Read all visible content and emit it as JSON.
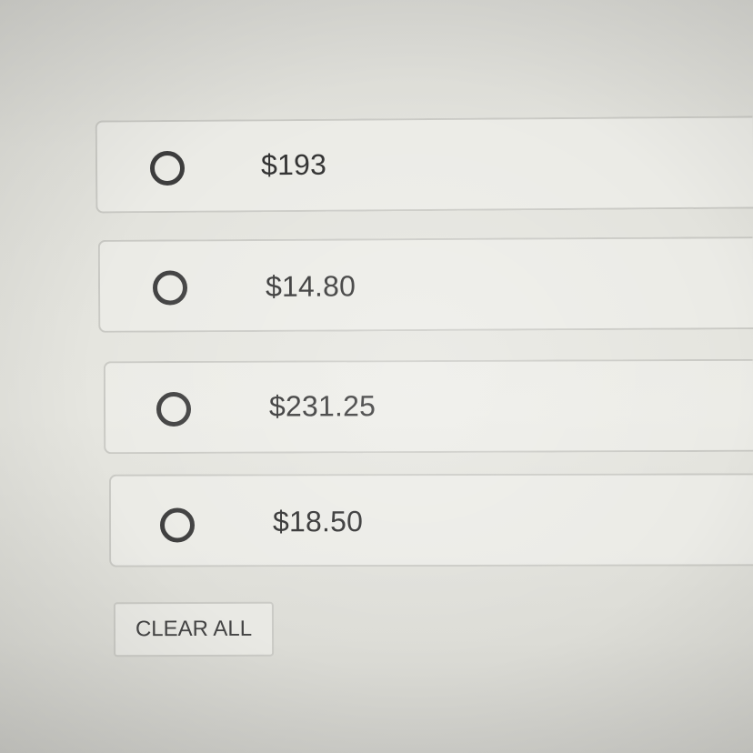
{
  "options": [
    {
      "label": "$193",
      "selected": false
    },
    {
      "label": "$14.80",
      "selected": false
    },
    {
      "label": "$231.25",
      "selected": false
    },
    {
      "label": "$18.50",
      "selected": false
    }
  ],
  "clear_button": {
    "label": "CLEAR ALL"
  },
  "icons": {
    "radio": "radio-unchecked-icon"
  }
}
